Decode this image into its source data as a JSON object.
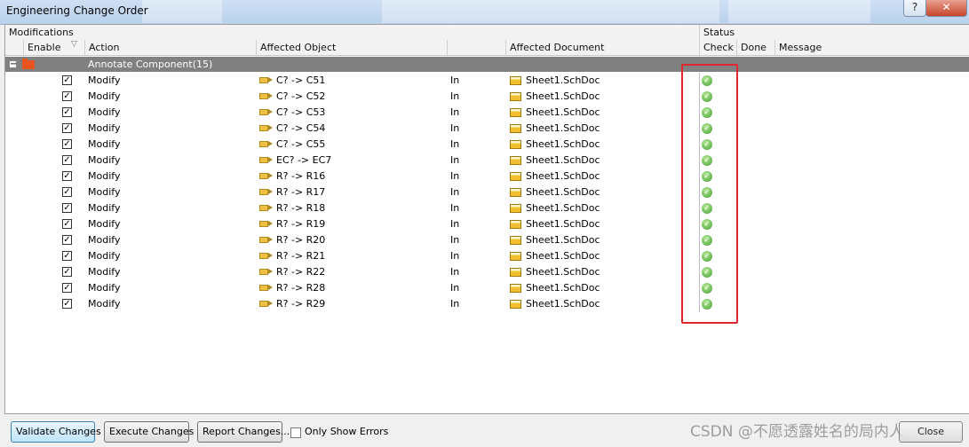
{
  "window": {
    "title": "Engineering Change Order",
    "help_label": "?",
    "close_label": "✕"
  },
  "header": {
    "modifications": "Modifications",
    "status": "Status"
  },
  "columns": {
    "enable": "Enable",
    "action": "Action",
    "affected_object": "Affected Object",
    "affected_document": "Affected Document",
    "check": "Check",
    "done": "Done",
    "message": "Message"
  },
  "group": {
    "label": "Annotate Component(15)",
    "expander": "−"
  },
  "rows": [
    {
      "enabled": true,
      "action": "Modify",
      "object": "C? -> C51",
      "in": "In",
      "document": "Sheet1.SchDoc",
      "check": "ok"
    },
    {
      "enabled": true,
      "action": "Modify",
      "object": "C? -> C52",
      "in": "In",
      "document": "Sheet1.SchDoc",
      "check": "ok"
    },
    {
      "enabled": true,
      "action": "Modify",
      "object": "C? -> C53",
      "in": "In",
      "document": "Sheet1.SchDoc",
      "check": "ok"
    },
    {
      "enabled": true,
      "action": "Modify",
      "object": "C? -> C54",
      "in": "In",
      "document": "Sheet1.SchDoc",
      "check": "ok"
    },
    {
      "enabled": true,
      "action": "Modify",
      "object": "C? -> C55",
      "in": "In",
      "document": "Sheet1.SchDoc",
      "check": "ok"
    },
    {
      "enabled": true,
      "action": "Modify",
      "object": "EC? -> EC7",
      "in": "In",
      "document": "Sheet1.SchDoc",
      "check": "ok"
    },
    {
      "enabled": true,
      "action": "Modify",
      "object": "R? -> R16",
      "in": "In",
      "document": "Sheet1.SchDoc",
      "check": "ok"
    },
    {
      "enabled": true,
      "action": "Modify",
      "object": "R? -> R17",
      "in": "In",
      "document": "Sheet1.SchDoc",
      "check": "ok"
    },
    {
      "enabled": true,
      "action": "Modify",
      "object": "R? -> R18",
      "in": "In",
      "document": "Sheet1.SchDoc",
      "check": "ok"
    },
    {
      "enabled": true,
      "action": "Modify",
      "object": "R? -> R19",
      "in": "In",
      "document": "Sheet1.SchDoc",
      "check": "ok"
    },
    {
      "enabled": true,
      "action": "Modify",
      "object": "R? -> R20",
      "in": "In",
      "document": "Sheet1.SchDoc",
      "check": "ok"
    },
    {
      "enabled": true,
      "action": "Modify",
      "object": "R? -> R21",
      "in": "In",
      "document": "Sheet1.SchDoc",
      "check": "ok"
    },
    {
      "enabled": true,
      "action": "Modify",
      "object": "R? -> R22",
      "in": "In",
      "document": "Sheet1.SchDoc",
      "check": "ok"
    },
    {
      "enabled": true,
      "action": "Modify",
      "object": "R? -> R28",
      "in": "In",
      "document": "Sheet1.SchDoc",
      "check": "ok"
    },
    {
      "enabled": true,
      "action": "Modify",
      "object": "R? -> R29",
      "in": "In",
      "document": "Sheet1.SchDoc",
      "check": "ok"
    }
  ],
  "buttons": {
    "validate": "Validate Changes",
    "execute": "Execute Changes",
    "report": "Report Changes...",
    "close": "Close"
  },
  "options": {
    "only_show_errors": "Only Show Errors",
    "only_show_errors_checked": false
  },
  "watermark": "CSDN @不愿透露姓名的局内人",
  "colors": {
    "highlight": "#e0262e",
    "group_row": "#808080",
    "check_ok": "#3d9b2d"
  }
}
